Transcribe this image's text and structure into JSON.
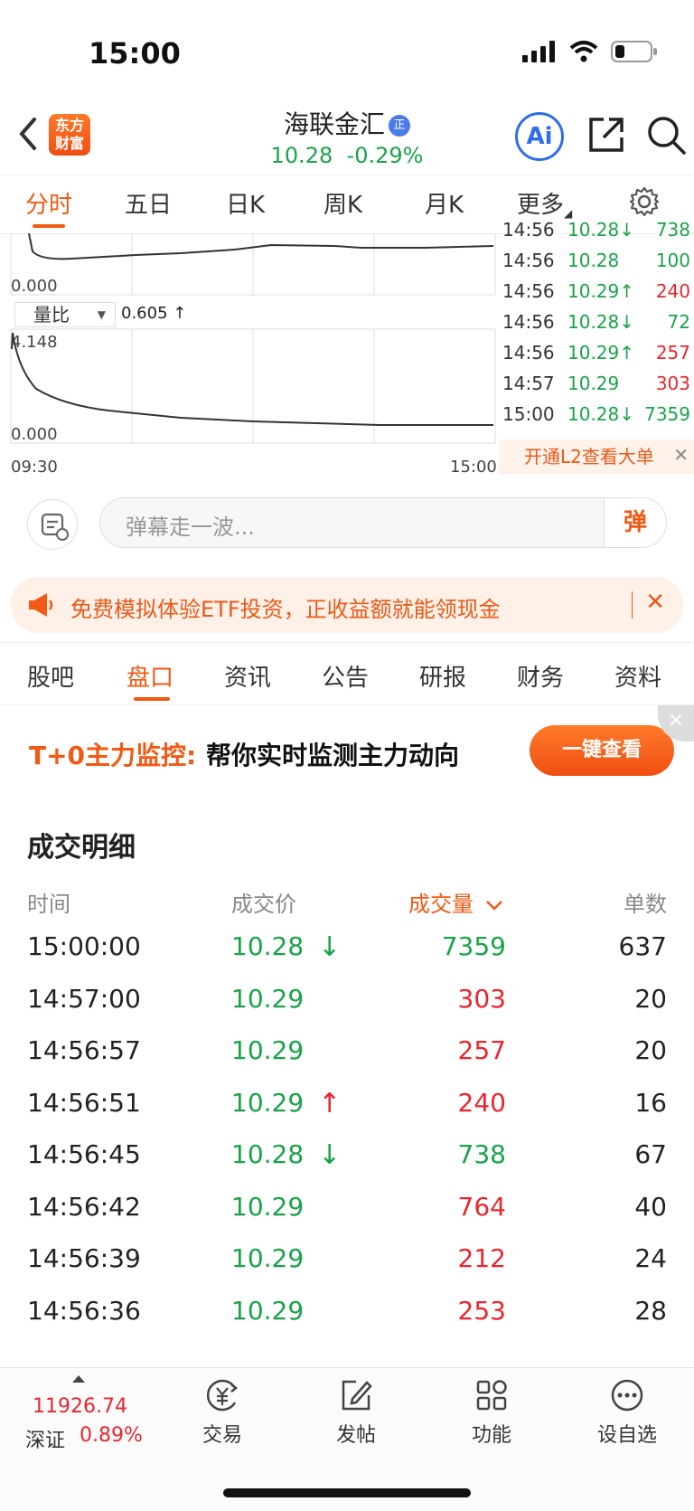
{
  "status_bar": {
    "time": "15:00"
  },
  "header": {
    "logo_text_line1": "东方",
    "logo_text_line2": "财富",
    "stock_name": "海联金汇",
    "badge": "正",
    "price": "10.28",
    "change_pct": "-0.29%",
    "ai_label": "Ai"
  },
  "chart_tabs": [
    "分时",
    "五日",
    "日K",
    "周K",
    "月K",
    "更多"
  ],
  "chart": {
    "price_axis_bottom": "0.000",
    "volume_ratio_label": "量比",
    "volume_ratio_value": "0.605 ↑",
    "volume_axis_top": "4.148",
    "volume_axis_bottom": "0.000",
    "time_start": "09:30",
    "time_end": "15:00"
  },
  "tick_list": [
    {
      "time": "14:56",
      "price": "10.28↓",
      "vol": "738",
      "dir": "down"
    },
    {
      "time": "14:56",
      "price": "10.28",
      "vol": "100",
      "dir": "flat"
    },
    {
      "time": "14:56",
      "price": "10.29↑",
      "vol": "240",
      "dir": "up"
    },
    {
      "time": "14:56",
      "price": "10.28↓",
      "vol": "72",
      "dir": "down"
    },
    {
      "time": "14:56",
      "price": "10.29↑",
      "vol": "257",
      "dir": "up"
    },
    {
      "time": "14:57",
      "price": "10.29",
      "vol": "303",
      "dir": "up"
    },
    {
      "time": "15:00",
      "price": "10.28↓",
      "vol": "7359",
      "dir": "down"
    }
  ],
  "l2_banner": "开通L2查看大单",
  "danmaku": {
    "placeholder": "弹幕走一波...",
    "send_label": "弹"
  },
  "promo": {
    "text": "免费模拟体验ETF投资，正收益额就能领现金"
  },
  "info_tabs": [
    "股吧",
    "盘口",
    "资讯",
    "公告",
    "研报",
    "财务",
    "资料"
  ],
  "t0": {
    "label": "T+0主力监控:",
    "text": "帮你实时监测主力动向",
    "button": "一键查看"
  },
  "trade_detail": {
    "title": "成交明细",
    "headers": {
      "time": "时间",
      "price": "成交价",
      "volume": "成交量",
      "count": "单数"
    },
    "rows": [
      {
        "time": "15:00:00",
        "price": "10.28",
        "arrow": "↓",
        "vol": "7359",
        "cnt": "637",
        "dir": "down"
      },
      {
        "time": "14:57:00",
        "price": "10.29",
        "arrow": "",
        "vol": "303",
        "cnt": "20",
        "dir": "up"
      },
      {
        "time": "14:56:57",
        "price": "10.29",
        "arrow": "",
        "vol": "257",
        "cnt": "20",
        "dir": "up"
      },
      {
        "time": "14:56:51",
        "price": "10.29",
        "arrow": "↑",
        "vol": "240",
        "cnt": "16",
        "dir": "up"
      },
      {
        "time": "14:56:45",
        "price": "10.28",
        "arrow": "↓",
        "vol": "738",
        "cnt": "67",
        "dir": "down"
      },
      {
        "time": "14:56:42",
        "price": "10.29",
        "arrow": "",
        "vol": "764",
        "cnt": "40",
        "dir": "up"
      },
      {
        "time": "14:56:39",
        "price": "10.29",
        "arrow": "",
        "vol": "212",
        "cnt": "24",
        "dir": "up"
      },
      {
        "time": "14:56:36",
        "price": "10.29",
        "arrow": "",
        "vol": "253",
        "cnt": "28",
        "dir": "up"
      }
    ]
  },
  "bottom_bar": {
    "index_value": "11926.74",
    "index_name": "深证",
    "index_pct": "0.89%",
    "nav": [
      "交易",
      "发帖",
      "功能",
      "设自选"
    ]
  },
  "colors": {
    "accent": "#f05a14",
    "up": "#e8262f",
    "down": "#1aa34a",
    "ai": "#2f6de8"
  }
}
